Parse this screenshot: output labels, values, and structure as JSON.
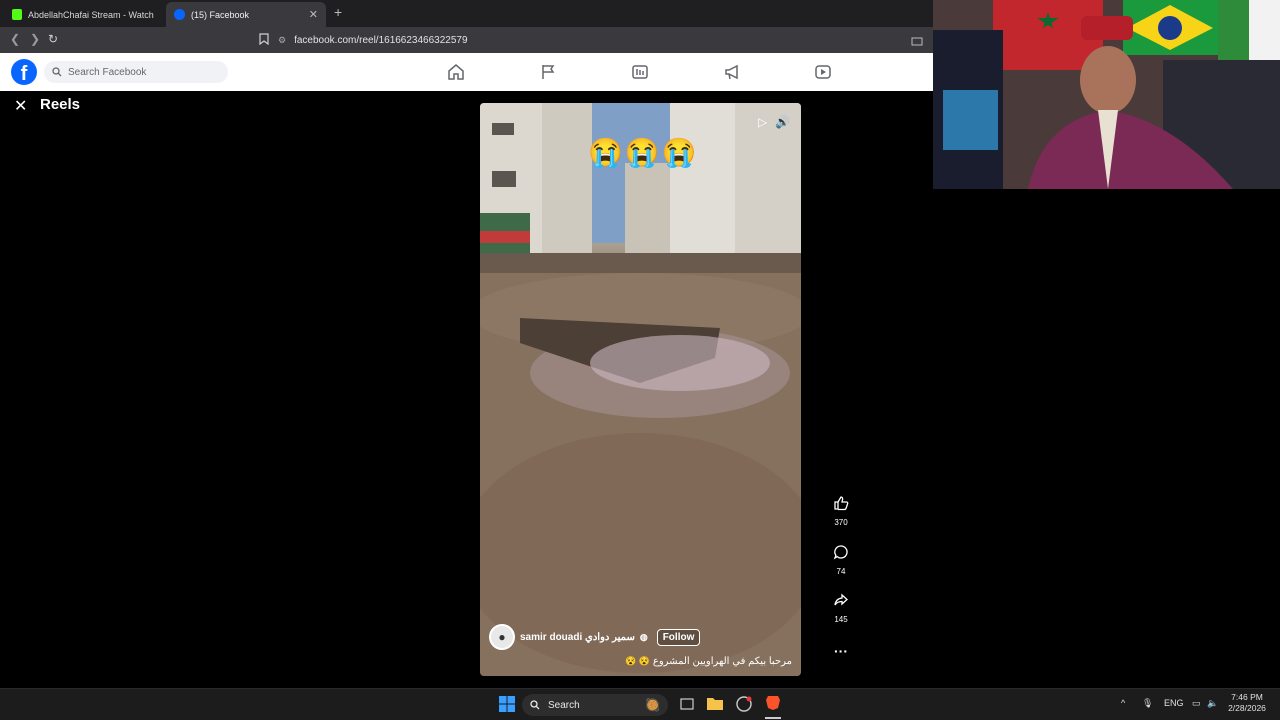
{
  "browser": {
    "tabs": [
      {
        "title": "AbdellahChafai Stream - Watch Live :",
        "favicon_color": "#53fc18"
      },
      {
        "title": "(15) Facebook",
        "favicon_color": "#0866ff"
      }
    ],
    "url": "facebook.com/reel/1616623466322579"
  },
  "facebook": {
    "logo_letter": "f",
    "search_placeholder": "Search Facebook",
    "nav_icons": [
      "home-icon",
      "flag-icon",
      "video-icon",
      "megaphone-icon",
      "watch-icon"
    ],
    "brand_color": "#0866ff"
  },
  "reels": {
    "title": "Reels",
    "overlay_emojis": "😭😭😭",
    "author": "samir douadi سمير دوادي",
    "follow_label": "Follow",
    "caption": "مرحبا بيكم في الهراويين المشروع",
    "likes": "370",
    "comments": "74",
    "shares": "145"
  },
  "taskbar": {
    "search_label": "Search",
    "lang": "ENG",
    "time": "7:46 PM",
    "date": "2/28/2026"
  }
}
